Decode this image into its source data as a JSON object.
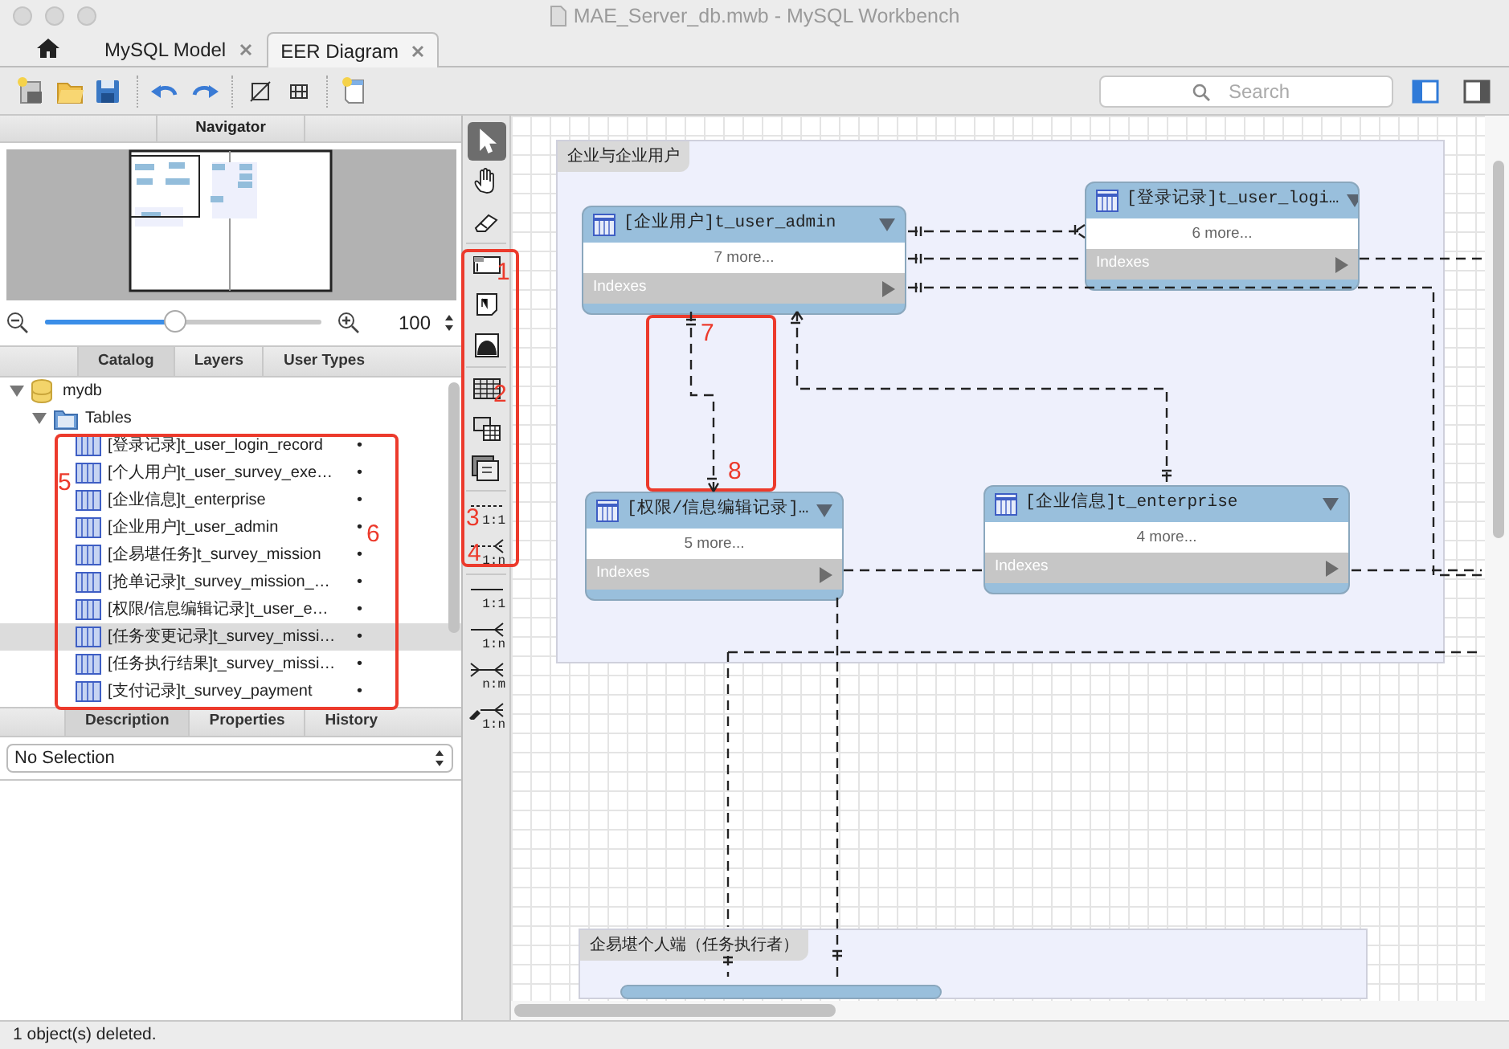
{
  "window": {
    "title": "MAE_Server_db.mwb - MySQL Workbench"
  },
  "tabs": [
    {
      "label": "MySQL Model",
      "selected": false
    },
    {
      "label": "EER Diagram",
      "selected": true
    }
  ],
  "search": {
    "placeholder": "Search"
  },
  "panel_toggles": [
    {
      "on": true
    },
    {
      "on": false
    }
  ],
  "navigator": {
    "title": "Navigator",
    "zoom": {
      "level": 0.47,
      "value": "100"
    }
  },
  "sidebar_tabs": [
    {
      "label": "Catalog",
      "selected": true
    },
    {
      "label": "Layers",
      "selected": false
    },
    {
      "label": "User Types",
      "selected": false
    }
  ],
  "catalog": {
    "items": [
      {
        "label": "mydb",
        "kind": "schema",
        "expanded": true,
        "selected": false,
        "children": [
          {
            "label": "Tables",
            "kind": "folder",
            "expanded": true,
            "selected": false,
            "children": [
              {
                "label": "[登录记录]t_user_login_record",
                "kind": "table",
                "selected": false,
                "dot": "•"
              },
              {
                "label": "[个人用户]t_user_survey_exe…",
                "kind": "table",
                "selected": false,
                "dot": "•"
              },
              {
                "label": "[企业信息]t_enterprise",
                "kind": "table",
                "selected": false,
                "dot": "•"
              },
              {
                "label": "[企业用户]t_user_admin",
                "kind": "table",
                "selected": false,
                "dot": "•"
              },
              {
                "label": "[企易堪任务]t_survey_mission",
                "kind": "table",
                "selected": false,
                "dot": "•"
              },
              {
                "label": "[抢单记录]t_survey_mission_…",
                "kind": "table",
                "selected": false,
                "dot": "•"
              },
              {
                "label": "[权限/信息编辑记录]t_user_e…",
                "kind": "table",
                "selected": false,
                "dot": "•"
              },
              {
                "label": "[任务变更记录]t_survey_missi…",
                "kind": "table",
                "selected": true,
                "dot": "•"
              },
              {
                "label": "[任务执行结果]t_survey_missi…",
                "kind": "table",
                "selected": false,
                "dot": "•"
              },
              {
                "label": "[支付记录]t_survey_payment",
                "kind": "table",
                "selected": false,
                "dot": "•"
              }
            ]
          }
        ]
      }
    ]
  },
  "info_tabs": [
    {
      "label": "Description",
      "selected": true
    },
    {
      "label": "Properties",
      "selected": false
    },
    {
      "label": "History",
      "selected": false
    }
  ],
  "selection_dropdown": {
    "value": "No Selection"
  },
  "tools": [
    {
      "kind": "pointer",
      "selected": true
    },
    {
      "kind": "hand",
      "selected": false
    },
    {
      "kind": "eraser",
      "selected": false
    },
    {
      "kind": "layer",
      "selected": false
    },
    {
      "kind": "note",
      "selected": false
    },
    {
      "kind": "image",
      "selected": false
    },
    {
      "kind": "table",
      "selected": false
    },
    {
      "kind": "view",
      "selected": false
    },
    {
      "kind": "routine",
      "selected": false
    },
    {
      "kind": "relation",
      "dashed": true,
      "many_left": false,
      "many_right": false,
      "picker": false,
      "label": "1:1",
      "selected": false
    },
    {
      "kind": "relation",
      "dashed": true,
      "many_left": false,
      "many_right": true,
      "picker": false,
      "label": "1:n",
      "selected": false
    },
    {
      "kind": "relation",
      "dashed": false,
      "many_left": false,
      "many_right": false,
      "picker": false,
      "label": "1:1",
      "selected": false
    },
    {
      "kind": "relation",
      "dashed": false,
      "many_left": false,
      "many_right": true,
      "picker": false,
      "label": "1:n",
      "selected": false
    },
    {
      "kind": "relation",
      "dashed": false,
      "many_left": true,
      "many_right": true,
      "picker": false,
      "label": "n:m",
      "selected": false
    },
    {
      "kind": "relation",
      "dashed": false,
      "many_left": false,
      "many_right": true,
      "picker": true,
      "label": "1:n",
      "selected": false
    }
  ],
  "diagram": {
    "layers": [
      {
        "title": "企业与企业用户"
      },
      {
        "title": "企易堪个人端（任务执行者）"
      }
    ],
    "tables": [
      {
        "kind": "full",
        "title": "[企业用户]t_user_admin",
        "more": "7 more...",
        "indexes": "Indexes"
      },
      {
        "kind": "full",
        "title": "[登录记录]t_user_logi…",
        "more": "6 more...",
        "indexes": "Indexes"
      },
      {
        "kind": "full",
        "title": "[权限/信息编辑记录]…",
        "more": "5 more...",
        "indexes": "Indexes"
      },
      {
        "kind": "full",
        "title": "[企业信息]t_enterprise",
        "more": "4 more...",
        "indexes": "Indexes"
      },
      {
        "kind": "cut"
      }
    ]
  },
  "annotations": [
    {
      "label": "1"
    },
    {
      "label": "2"
    },
    {
      "label": "3"
    },
    {
      "label": "4"
    },
    {
      "label": "5"
    },
    {
      "label": "6"
    },
    {
      "label": "7"
    },
    {
      "label": "8"
    }
  ],
  "status_bar": "1 object(s) deleted."
}
